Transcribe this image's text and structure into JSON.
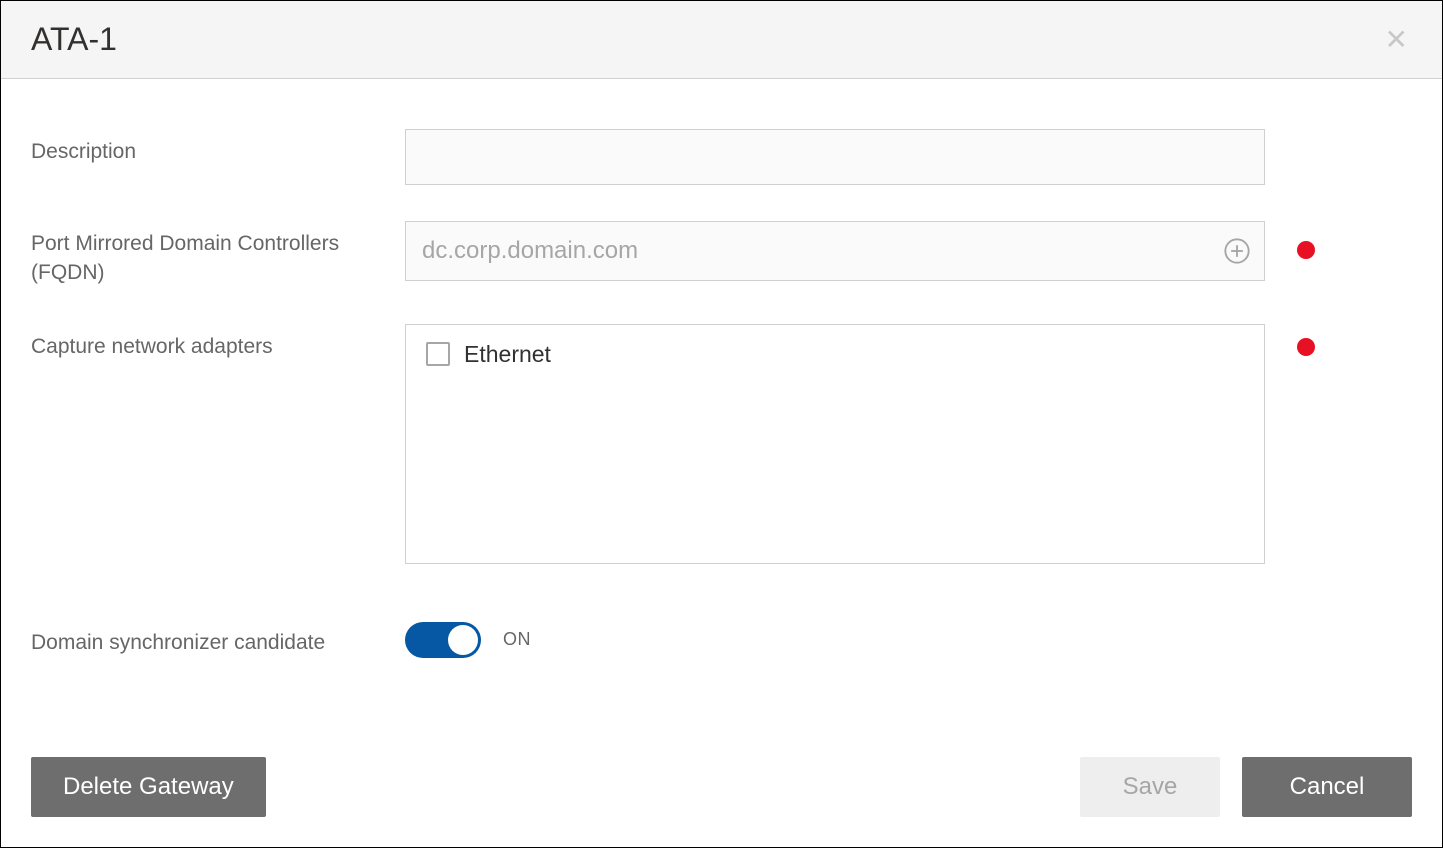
{
  "dialog": {
    "title": "ATA-1"
  },
  "form": {
    "description": {
      "label": "Description",
      "value": ""
    },
    "fqdn": {
      "label": "Port Mirrored Domain Controllers (FQDN)",
      "placeholder": "dc.corp.domain.com",
      "value": "",
      "status": "error"
    },
    "adapters": {
      "label": "Capture network adapters",
      "items": [
        {
          "label": "Ethernet",
          "checked": false
        }
      ],
      "status": "error"
    },
    "sync": {
      "label": "Domain synchronizer candidate",
      "on": true,
      "state_label": "ON"
    }
  },
  "buttons": {
    "delete": "Delete Gateway",
    "save": "Save",
    "cancel": "Cancel"
  },
  "colors": {
    "error_dot": "#e81123",
    "toggle_on": "#0658a5",
    "button_gray": "#6e6e6e"
  }
}
